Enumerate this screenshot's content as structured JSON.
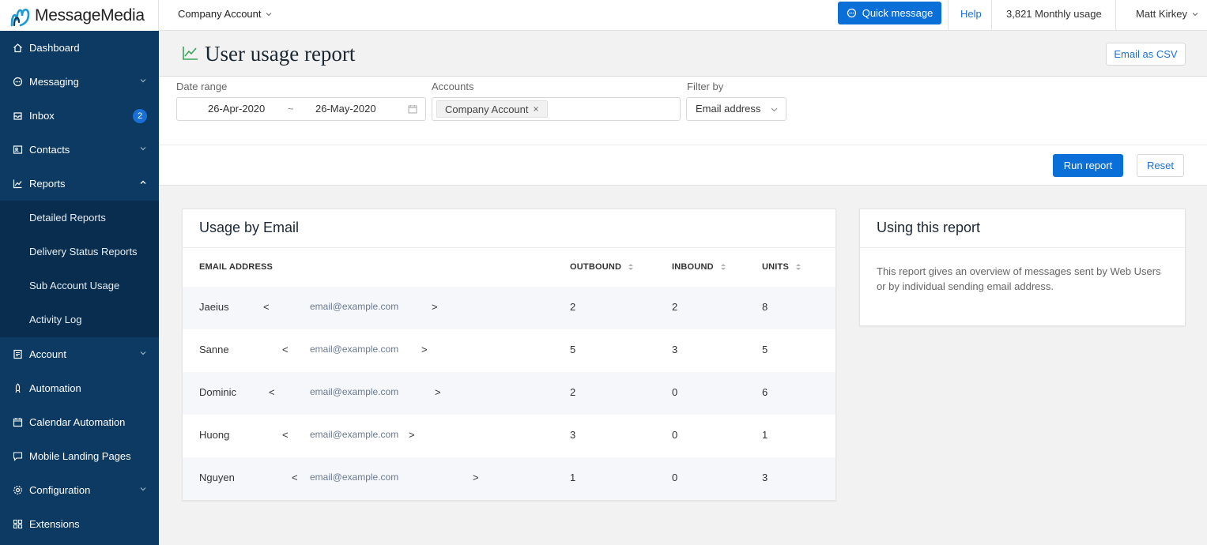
{
  "brand": {
    "name": "MessageMedia"
  },
  "topbar": {
    "account": "Company Account",
    "quick_message": "Quick message",
    "help": "Help",
    "usage": "3,821 Monthly usage",
    "user": "Matt Kirkey"
  },
  "sidebar": {
    "items": [
      {
        "label": "Dashboard"
      },
      {
        "label": "Messaging"
      },
      {
        "label": "Inbox",
        "badge": "2"
      },
      {
        "label": "Contacts"
      },
      {
        "label": "Reports"
      },
      {
        "label": "Account"
      },
      {
        "label": "Automation"
      },
      {
        "label": "Calendar Automation"
      },
      {
        "label": "Mobile Landing Pages"
      },
      {
        "label": "Configuration"
      },
      {
        "label": "Extensions"
      }
    ],
    "report_subitems": [
      {
        "label": "Detailed Reports"
      },
      {
        "label": "Delivery Status Reports"
      },
      {
        "label": "Sub Account Usage"
      },
      {
        "label": "Activity Log"
      }
    ]
  },
  "page": {
    "title": "User usage report",
    "email_csv": "Email as CSV"
  },
  "filters": {
    "date_range_label": "Date range",
    "start_date": "26-Apr-2020",
    "separator": "~",
    "end_date": "26-May-2020",
    "accounts_label": "Accounts",
    "account_chip": "Company Account",
    "chip_remove": "×",
    "filter_by_label": "Filter by",
    "filter_by_value": "Email address",
    "run_report": "Run report",
    "reset": "Reset"
  },
  "usage_card": {
    "title": "Usage by Email",
    "columns": {
      "email": "EMAIL ADDRESS",
      "outbound": "OUTBOUND",
      "inbound": "INBOUND",
      "units": "UNITS"
    },
    "rows": [
      {
        "name": "Jaeius",
        "lt": "<",
        "email": "email@example.com",
        "gt": ">",
        "outbound": "2",
        "inbound": "2",
        "units": "8"
      },
      {
        "name": "Sanne",
        "lt": "<",
        "email": "email@example.com",
        "gt": ">",
        "outbound": "5",
        "inbound": "3",
        "units": "5"
      },
      {
        "name": "Dominic",
        "lt": "<",
        "email": "email@example.com",
        "gt": ">",
        "outbound": "2",
        "inbound": "0",
        "units": "6"
      },
      {
        "name": "Huong",
        "lt": "<",
        "email": "email@example.com",
        "gt": ">",
        "outbound": "3",
        "inbound": "0",
        "units": "1"
      },
      {
        "name": "Nguyen",
        "lt": "<",
        "email": "email@example.com",
        "gt": ">",
        "outbound": "1",
        "inbound": "0",
        "units": "3"
      }
    ]
  },
  "info_card": {
    "title": "Using this report",
    "text": "This report gives an overview of messages sent by Web Users or by individual sending email address."
  },
  "colors": {
    "sidebar": "#0c3a62",
    "sidebar_sub": "#082d4e",
    "primary": "#0a6fd6",
    "title_icon": "#3aa35b"
  },
  "icons": {
    "dashboard": "home-icon",
    "messaging": "chat-icon",
    "inbox": "tray-icon",
    "contacts": "address-book-icon",
    "reports": "line-chart-icon",
    "account": "document-icon",
    "automation": "rocket-icon",
    "calendar": "calendar-icon",
    "landing": "monitor-icon",
    "configuration": "gear-icon",
    "extensions": "grid-icon"
  }
}
